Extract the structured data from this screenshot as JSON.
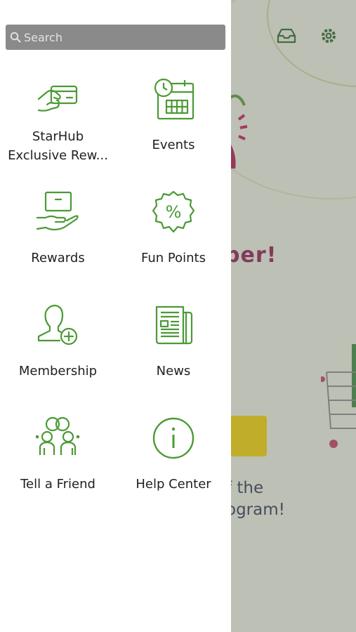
{
  "search": {
    "placeholder": "Search"
  },
  "menu": {
    "items": [
      {
        "label": "StarHub Exclusive Rew...",
        "icon": "credit-card-hand-icon"
      },
      {
        "label": "Events",
        "icon": "calendar-clock-icon"
      },
      {
        "label": "Rewards",
        "icon": "gift-hand-icon"
      },
      {
        "label": "Fun Points",
        "icon": "percent-badge-icon"
      },
      {
        "label": "Membership",
        "icon": "user-add-icon"
      },
      {
        "label": "News",
        "icon": "newspaper-icon"
      },
      {
        "label": "Tell a Friend",
        "icon": "friends-group-icon"
      },
      {
        "label": "Help Center",
        "icon": "info-circle-icon"
      }
    ]
  },
  "background": {
    "headline_fragment": "ber!",
    "text_line1": "f the",
    "text_line2": "ogram!"
  },
  "colors": {
    "icon_green": "#4b9a35",
    "drawer_bg": "#ffffff",
    "search_bg": "#8a8a8a"
  }
}
